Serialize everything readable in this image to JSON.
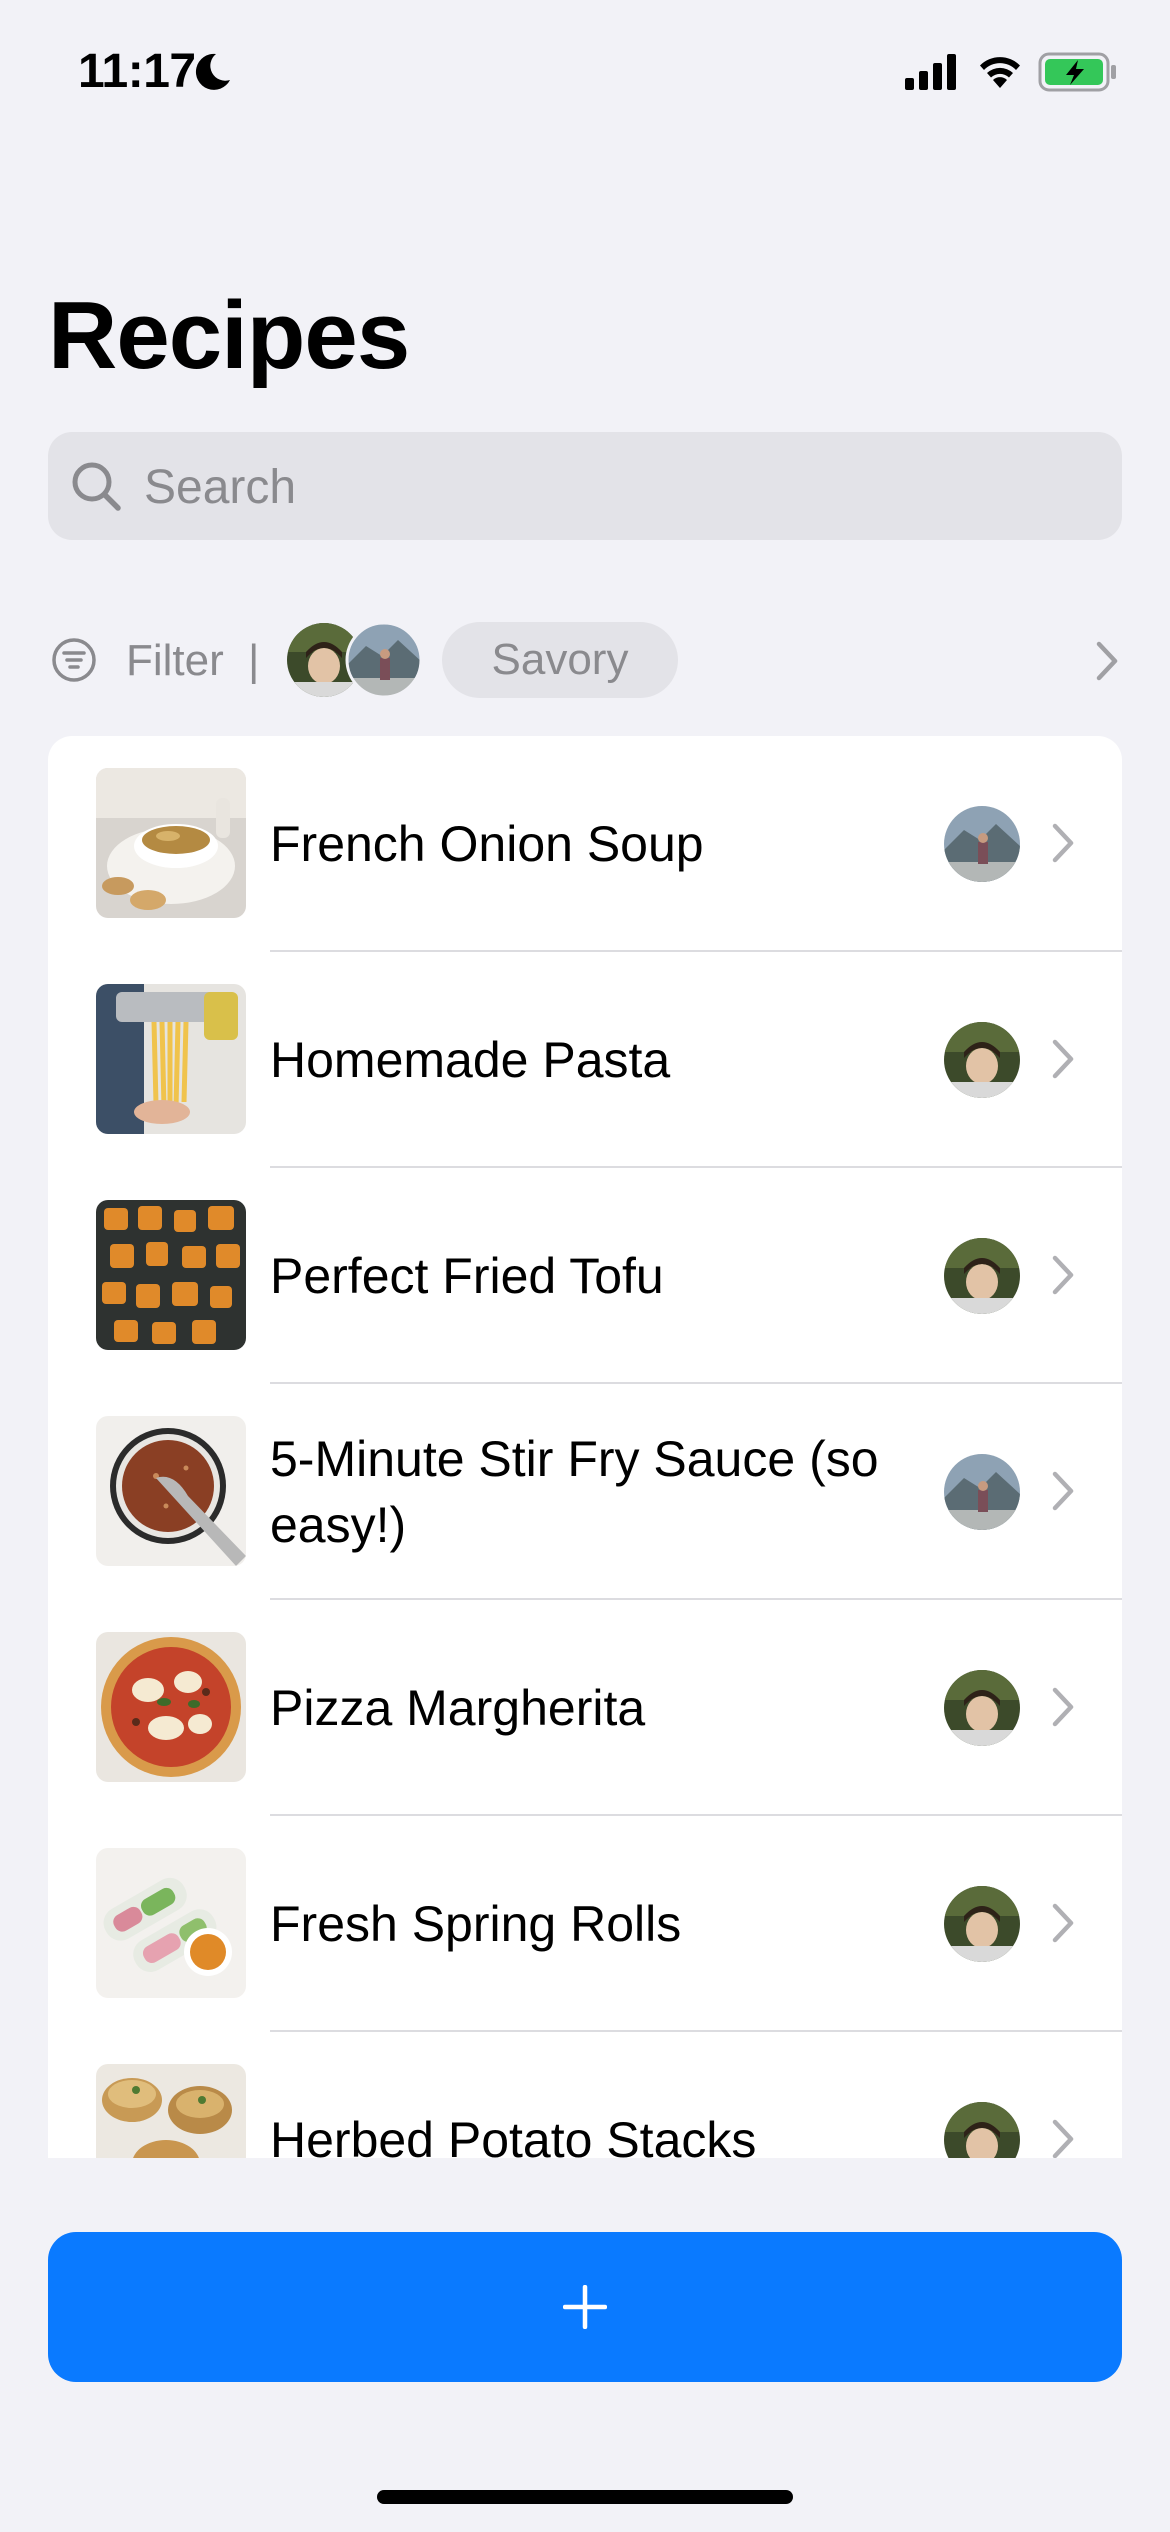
{
  "status_bar": {
    "time": "11:17",
    "icons": [
      "moon-icon",
      "cellular-signal-icon",
      "wifi-icon",
      "battery-charging-icon"
    ],
    "battery_color": "#34c759"
  },
  "header": {
    "title": "Recipes"
  },
  "search": {
    "placeholder": "Search",
    "value": ""
  },
  "filter": {
    "label": "Filter",
    "separator": "|",
    "chip": "Savory",
    "user_avatars": [
      "user-avatar-1",
      "user-avatar-2"
    ]
  },
  "recipes": [
    {
      "name": "French Onion Soup",
      "owner": "user-avatar-2"
    },
    {
      "name": "Homemade Pasta",
      "owner": "user-avatar-1"
    },
    {
      "name": "Perfect Fried Tofu",
      "owner": "user-avatar-1"
    },
    {
      "name": "5-Minute Stir Fry Sauce (so easy!)",
      "owner": "user-avatar-2"
    },
    {
      "name": "Pizza Margherita",
      "owner": "user-avatar-1"
    },
    {
      "name": "Fresh Spring Rolls",
      "owner": "user-avatar-1"
    },
    {
      "name": "Herbed Potato Stacks",
      "owner": "user-avatar-1"
    }
  ],
  "add_button": {
    "icon": "plus-icon",
    "color": "#0a7aff"
  },
  "colors": {
    "background": "#f2f2f7",
    "accent": "#0a7aff",
    "secondary_text": "#8a8a8e"
  }
}
